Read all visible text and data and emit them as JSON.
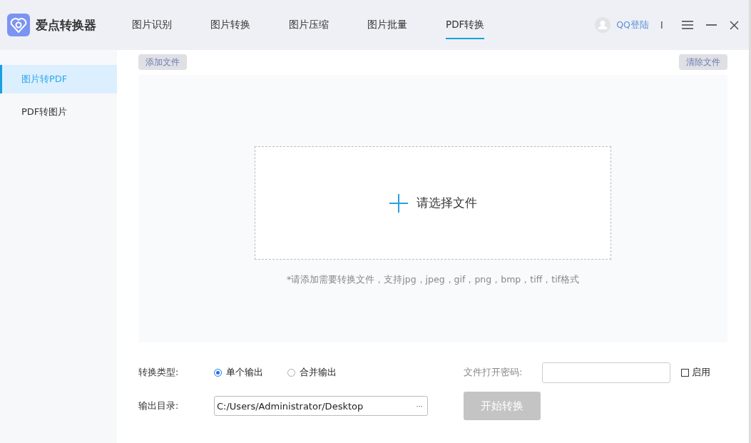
{
  "app": {
    "title": "爱点转换器"
  },
  "nav": [
    {
      "label": "图片识别",
      "selected": false
    },
    {
      "label": "图片转换",
      "selected": false
    },
    {
      "label": "图片压缩",
      "selected": false
    },
    {
      "label": "图片批量",
      "selected": false
    },
    {
      "label": "PDF转换",
      "selected": true
    }
  ],
  "login": {
    "label": "QQ登陆"
  },
  "separator": "I",
  "sidebar": {
    "items": [
      {
        "label": "图片转PDF",
        "selected": true
      },
      {
        "label": "PDF转图片",
        "selected": false
      }
    ]
  },
  "toolbar": {
    "add_button": "添加文件",
    "clear_button": "清除文件"
  },
  "dropzone": {
    "label": "请选择文件",
    "hint": "*请添加需要转换文件，支持jpg，jpeg，gif，png，bmp，tiff，tif格式"
  },
  "form": {
    "type_label": "转换类型:",
    "options": [
      {
        "label": "单个输出",
        "selected": true
      },
      {
        "label": "合并输出",
        "selected": false
      }
    ],
    "password_label": "文件打开密码:",
    "enable": {
      "label": "启用",
      "checked": false
    },
    "output_label": "输出目录:",
    "output_path": "C:/Users/Administrator/Desktop",
    "browse": "···",
    "start_button": {
      "label": "开始转换",
      "disabled": true
    }
  }
}
